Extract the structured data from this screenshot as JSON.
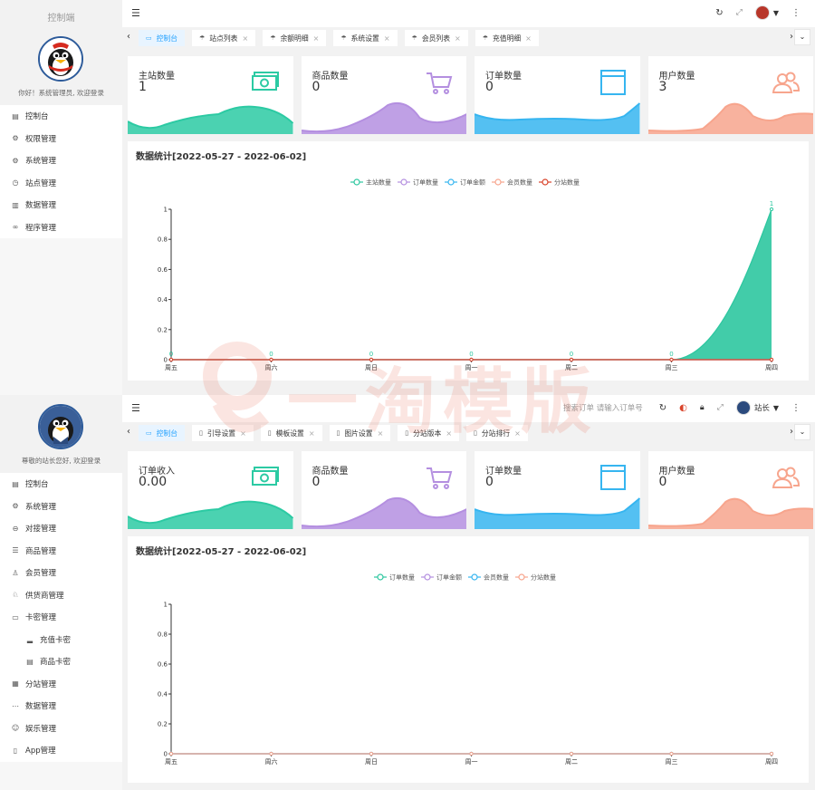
{
  "top": {
    "brand": "控制端",
    "welcome": "你好！系统管理员, 欢迎登录",
    "menu": [
      {
        "icon": "dashboard-icon",
        "glyph": "▤",
        "label": "控制台"
      },
      {
        "icon": "gear-icon",
        "glyph": "⚙",
        "label": "权限管理"
      },
      {
        "icon": "gear-icon",
        "glyph": "⚙",
        "label": "系统管理"
      },
      {
        "icon": "clock-icon",
        "glyph": "◷",
        "label": "站点管理"
      },
      {
        "icon": "grid-icon",
        "glyph": "▥",
        "label": "数据管理"
      },
      {
        "icon": "infinity-icon",
        "glyph": "∞",
        "label": "程序管理"
      }
    ],
    "tabs": [
      {
        "label": "控制台",
        "active": true,
        "closable": false
      },
      {
        "label": "站点列表",
        "active": false,
        "closable": true
      },
      {
        "label": "余额明细",
        "active": false,
        "closable": true
      },
      {
        "label": "系统设置",
        "active": false,
        "closable": true
      },
      {
        "label": "会员列表",
        "active": false,
        "closable": true
      },
      {
        "label": "充值明细",
        "active": false,
        "closable": true
      }
    ],
    "cards": [
      {
        "title": "主站数量",
        "value": "1",
        "color": "#2ccaa3",
        "icon": "cash-icon"
      },
      {
        "title": "商品数量",
        "value": "0",
        "color": "#b48fe0",
        "icon": "cart-icon"
      },
      {
        "title": "订单数量",
        "value": "0",
        "color": "#36b5f0",
        "icon": "window-icon"
      },
      {
        "title": "用户数量",
        "value": "3",
        "color": "#f7a58d",
        "icon": "users-icon"
      }
    ],
    "chart_title": "数据统计[2022-05-27 - 2022-06-02]"
  },
  "bottom": {
    "welcome": "尊敬的站长您好, 欢迎登录",
    "search_placeholder": "搜索订单 请输入订单号",
    "user_label": "站长",
    "menu": [
      {
        "icon": "dashboard-icon",
        "glyph": "▤",
        "label": "控制台",
        "sub": false
      },
      {
        "icon": "gear-icon",
        "glyph": "⚙",
        "label": "系统管理",
        "sub": false
      },
      {
        "icon": "link-icon",
        "glyph": "⊖",
        "label": "对接管理",
        "sub": false
      },
      {
        "icon": "database-icon",
        "glyph": "☰",
        "label": "商品管理",
        "sub": false
      },
      {
        "icon": "user-icon",
        "glyph": "♙",
        "label": "会员管理",
        "sub": false
      },
      {
        "icon": "supplier-icon",
        "glyph": "♘",
        "label": "供货商管理",
        "sub": false
      },
      {
        "icon": "folder-icon",
        "glyph": "▭",
        "label": "卡密管理",
        "sub": false
      },
      {
        "icon": "signal-icon",
        "glyph": "▂",
        "label": "充值卡密",
        "sub": true
      },
      {
        "icon": "card-icon",
        "glyph": "▤",
        "label": "商品卡密",
        "sub": true
      },
      {
        "icon": "apps-icon",
        "glyph": "▦",
        "label": "分站管理",
        "sub": false
      },
      {
        "icon": "more-icon",
        "glyph": "⋯",
        "label": "数据管理",
        "sub": false
      },
      {
        "icon": "entertainment-icon",
        "glyph": "☺",
        "label": "娱乐管理",
        "sub": false
      },
      {
        "icon": "mobile-icon",
        "glyph": "▯",
        "label": "App管理",
        "sub": false
      }
    ],
    "tabs": [
      {
        "label": "控制台",
        "active": true,
        "closable": false
      },
      {
        "label": "引导设置",
        "active": false,
        "closable": true
      },
      {
        "label": "模板设置",
        "active": false,
        "closable": true
      },
      {
        "label": "图片设置",
        "active": false,
        "closable": true
      },
      {
        "label": "分站版本",
        "active": false,
        "closable": true
      },
      {
        "label": "分站排行",
        "active": false,
        "closable": true
      }
    ],
    "cards": [
      {
        "title": "订单收入",
        "value": "0.00",
        "color": "#2ccaa3",
        "icon": "cash-icon"
      },
      {
        "title": "商品数量",
        "value": "0",
        "color": "#b48fe0",
        "icon": "cart-icon"
      },
      {
        "title": "订单数量",
        "value": "0",
        "color": "#36b5f0",
        "icon": "window-icon"
      },
      {
        "title": "用户数量",
        "value": "0",
        "color": "#f7a58d",
        "icon": "users-icon"
      }
    ],
    "chart_title": "数据统计[2022-05-27 - 2022-06-02]"
  },
  "watermark": "一淘模版",
  "chart_data": [
    {
      "type": "line",
      "x": [
        "周五",
        "周六",
        "周日",
        "周一",
        "周二",
        "周三",
        "周四"
      ],
      "series": [
        {
          "name": "主站数量",
          "values": [
            0,
            0,
            0,
            0,
            0,
            0,
            1
          ],
          "color": "#2ec7a0",
          "area": true,
          "labels": true
        },
        {
          "name": "订单数量",
          "values": [
            0,
            0,
            0,
            0,
            0,
            0,
            0
          ],
          "color": "#b48fe0"
        },
        {
          "name": "订单金额",
          "values": [
            0,
            0,
            0,
            0,
            0,
            0,
            0
          ],
          "color": "#36b5f0"
        },
        {
          "name": "会员数量",
          "values": [
            0,
            0,
            0,
            0,
            0,
            0,
            0
          ],
          "color": "#f7a58d"
        },
        {
          "name": "分站数量",
          "values": [
            0,
            0,
            0,
            0,
            0,
            0,
            0
          ],
          "color": "#d9432a"
        }
      ],
      "yticks": [
        "0",
        "0.2",
        "0.4",
        "0.6",
        "0.8",
        "1"
      ],
      "ylim": [
        0,
        1
      ],
      "legend": "top-center",
      "grid": false
    },
    {
      "type": "line",
      "x": [
        "周五",
        "周六",
        "周日",
        "周一",
        "周二",
        "周三",
        "周四"
      ],
      "series": [
        {
          "name": "订单数量",
          "values": [
            0,
            0,
            0,
            0,
            0,
            0,
            0
          ],
          "color": "#2ec7a0"
        },
        {
          "name": "订单金额",
          "values": [
            0,
            0,
            0,
            0,
            0,
            0,
            0
          ],
          "color": "#b48fe0"
        },
        {
          "name": "会员数量",
          "values": [
            0,
            0,
            0,
            0,
            0,
            0,
            0
          ],
          "color": "#36b5f0"
        },
        {
          "name": "分站数量",
          "values": [
            0,
            0,
            0,
            0,
            0,
            0,
            0
          ],
          "color": "#f7a58d"
        }
      ],
      "yticks": [
        "0",
        "0.2",
        "0.4",
        "0.6",
        "0.8",
        "1"
      ],
      "ylim": [
        0,
        1
      ],
      "legend": "top-center",
      "grid": false
    }
  ]
}
